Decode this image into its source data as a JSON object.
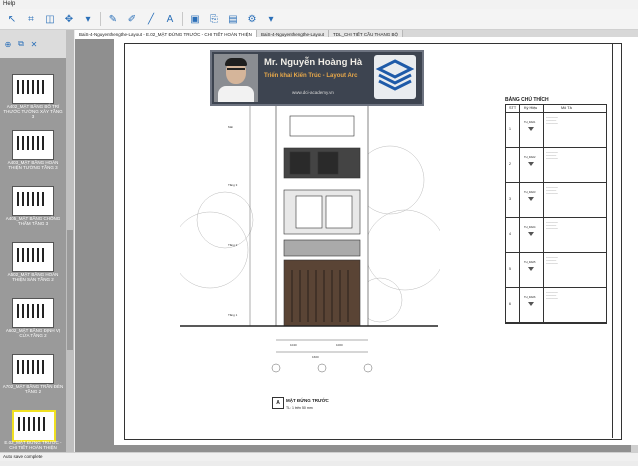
{
  "menu": {
    "help": "Help"
  },
  "toolbar": {
    "icons": [
      "cursor-icon",
      "crop-icon",
      "snapshot-icon",
      "eraser-icon",
      "line-icon",
      "pen-icon",
      "pen-alt-icon",
      "text-icon",
      "page-icon",
      "export-icon",
      "pdf-icon",
      "settings-icon"
    ]
  },
  "tabs": [
    {
      "label": "BaiS-4-Nguyenthengthe-Layout - E.02_MẶT ĐỨNG TRƯỚC - CHI TIẾT HOÀN THIỆN",
      "active": true
    },
    {
      "label": "BaiS-4-Nguyenthengthe-Layout",
      "active": false
    },
    {
      "label": "TDL_CHI TIẾT CẦU THANG BỘ",
      "active": false
    }
  ],
  "thumbnails": [
    {
      "caption": "A402_MẶT BẰNG BỐ TRÍ THƯỚC TƯỜNG XÂY TẦNG 3",
      "selected": false
    },
    {
      "caption": "A403_MẶT BẰNG HOÀN THIỆN TƯỜNG TẦNG 3",
      "selected": false
    },
    {
      "caption": "A405_MẶT BẰNG CHỐNG THẤM TẦNG 3",
      "selected": false
    },
    {
      "caption": "A502_MẶT BẰNG HOÀN THIỆN SÀN TẦNG 2",
      "selected": false
    },
    {
      "caption": "A602_MẶT BẰNG ĐỊNH VỊ CỬA TẦNG 2",
      "selected": false
    },
    {
      "caption": "A702_MẶT BẰNG TRẦN ĐÈN TẦNG 2",
      "selected": false
    },
    {
      "caption": "E.02_MẶT ĐỨNG TRƯỚC - CHI TIẾT HOÀN THIỆN",
      "selected": true
    }
  ],
  "overlay": {
    "name": "Mr. Nguyễn Hoàng Hà",
    "subtitle": "Triển khai Kiến Trúc - Layout Arc",
    "website": "www.dci-academy.vn"
  },
  "legend": {
    "title": "BẢNG CHÚ THÍCH",
    "headers": [
      "STT",
      "Ký Hiệu",
      "Mô Tả"
    ],
    "rows": [
      {
        "n": "1",
        "code": "TH_DA01"
      },
      {
        "n": "2",
        "code": "TH_DA02"
      },
      {
        "n": "3",
        "code": "TH_DA03"
      },
      {
        "n": "4",
        "code": "TH_DA04"
      },
      {
        "n": "5",
        "code": "TH_DA05"
      },
      {
        "n": "6",
        "code": "TH_DA06"
      }
    ]
  },
  "drawing": {
    "caption_number": "A",
    "caption_title": "MẶT ĐỨNG TRƯỚC",
    "caption_scale": "TL: 1 trên 50 mm",
    "levels": [
      "Mái",
      "Tầng 3",
      "Tầng 2",
      "Tầng 1"
    ],
    "dims": [
      "1040",
      "1000",
      "1200",
      "1600"
    ]
  },
  "status": {
    "text": "Auto save complete"
  }
}
